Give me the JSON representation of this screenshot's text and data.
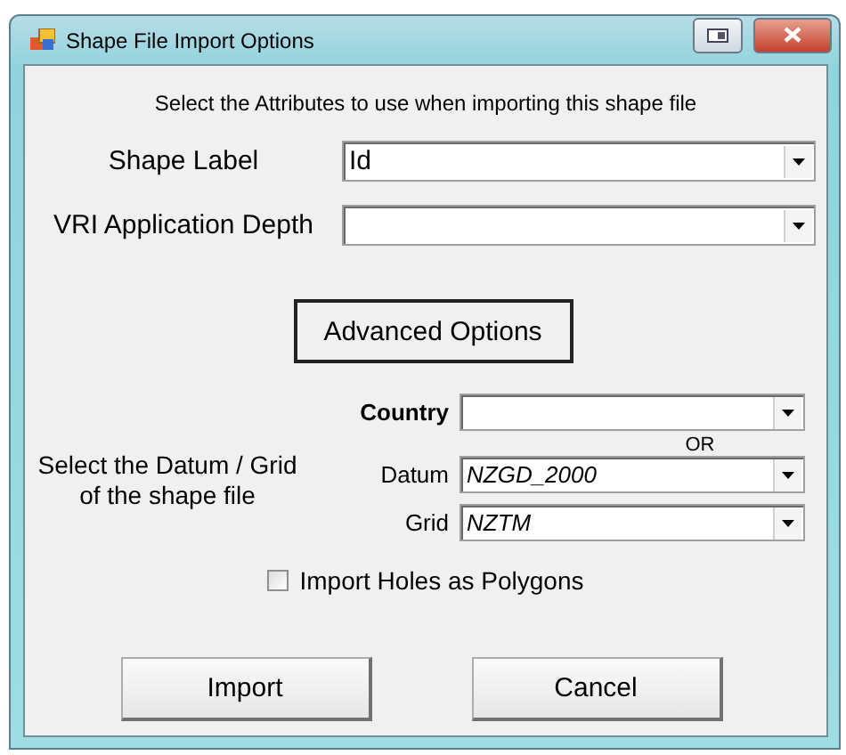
{
  "window": {
    "title": "Shape File Import Options"
  },
  "intro": "Select the Attributes to use when importing this shape file",
  "attribute_fields": [
    {
      "label": "Shape Label",
      "value": "Id"
    },
    {
      "label": "VRI Application Depth"
    }
  ],
  "advanced_button": "Advanced Options",
  "projection": {
    "label": "Select the Datum / Grid of the shape file",
    "country": {
      "label": "Country"
    },
    "separator": "OR",
    "datum": {
      "label": "Datum",
      "value": "NZGD_2000"
    },
    "grid": {
      "label": "Grid",
      "value": "NZTM"
    }
  },
  "holes_checkbox": {
    "label": "Import Holes as Polygons",
    "checked": false
  },
  "buttons": [
    "Import",
    "Cancel"
  ]
}
